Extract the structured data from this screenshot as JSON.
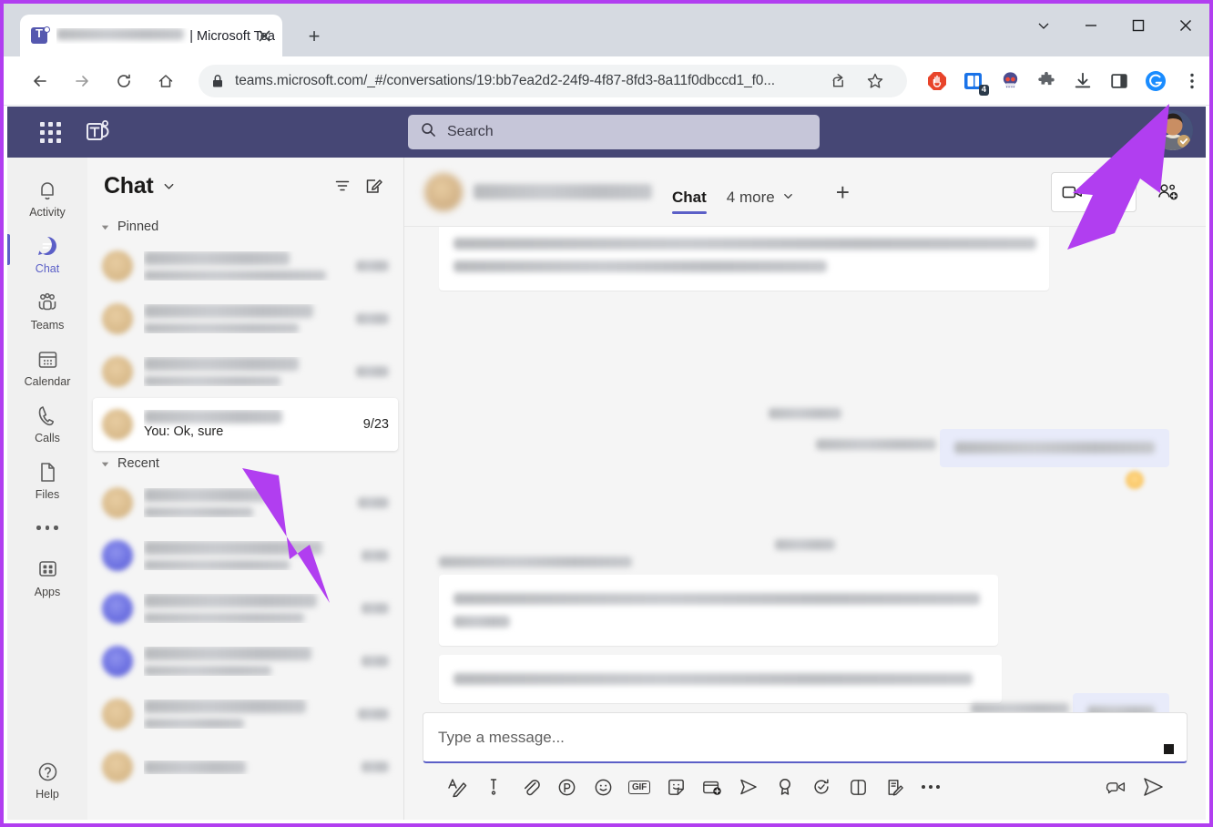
{
  "browser": {
    "tab": {
      "title_suffix": "| Microsoft Tea",
      "favicon": "teams-logo-icon",
      "close": "close-icon"
    },
    "new_tab_label": "+",
    "window_controls": {
      "tab_search": "chevron-down-icon",
      "minimize": "minimize-icon",
      "maximize": "maximize-icon",
      "close": "close-icon"
    },
    "nav": {
      "back": "back-arrow-icon",
      "forward": "forward-arrow-icon",
      "reload": "reload-icon",
      "home": "home-icon"
    },
    "omnibox": {
      "lock": "lock-icon",
      "url": "teams.microsoft.com/_#/conversations/19:bb7ea2d2-24f9-4f87-8fd3-8a11f0dbccd1_f0...",
      "share": "share-icon",
      "bookmark": "star-icon"
    },
    "extensions": [
      {
        "name": "adblock-icon",
        "color": "#e8442a"
      },
      {
        "name": "tab-manager-icon",
        "color": "#1a73e8",
        "badge": "4"
      },
      {
        "name": "skull-emoji-icon",
        "color": "#5b5fc7"
      },
      {
        "name": "puzzle-piece-icon",
        "color": "#5f6368"
      },
      {
        "name": "download-icon",
        "color": "#3c4043"
      },
      {
        "name": "side-panel-icon",
        "color": "#3c4043"
      },
      {
        "name": "grammarly-icon",
        "color": "#1a8cff"
      },
      {
        "name": "chrome-menu-icon",
        "color": "#3c4043"
      }
    ]
  },
  "teams": {
    "topbar": {
      "waffle": "app-grid-icon",
      "logo": "teams-logo-icon",
      "search_placeholder": "Search",
      "search_icon": "search-icon",
      "avatar": "user-avatar"
    },
    "rail": [
      {
        "label": "Activity",
        "icon": "bell-icon",
        "active": false
      },
      {
        "label": "Chat",
        "icon": "chat-bubble-icon",
        "active": true
      },
      {
        "label": "Teams",
        "icon": "people-icon",
        "active": false
      },
      {
        "label": "Calendar",
        "icon": "calendar-icon",
        "active": false
      },
      {
        "label": "Calls",
        "icon": "phone-icon",
        "active": false
      },
      {
        "label": "Files",
        "icon": "file-icon",
        "active": false
      }
    ],
    "rail_more": "more-icon",
    "rail_apps": {
      "label": "Apps",
      "icon": "apps-grid-icon"
    },
    "rail_help": {
      "label": "Help",
      "icon": "help-circle-icon"
    },
    "chatlist": {
      "title": "Chat",
      "title_chevron": "chevron-down-icon",
      "filter_icon": "filter-icon",
      "compose_icon": "new-chat-icon",
      "sections": [
        {
          "label": "Pinned",
          "rows": [
            {
              "avatar": "tan",
              "name_redacted": true,
              "sub_redacted": true,
              "time_redacted": true,
              "selected": false
            },
            {
              "avatar": "tan",
              "name_redacted": true,
              "sub_redacted": true,
              "time_redacted": true,
              "selected": false
            },
            {
              "avatar": "tan",
              "name_redacted": true,
              "sub_redacted": true,
              "time_redacted": true,
              "selected": false
            },
            {
              "avatar": "tan",
              "name_redacted": true,
              "sub_text": "You: Ok, sure",
              "time": "9/23",
              "selected": true
            }
          ]
        },
        {
          "label": "Recent",
          "rows": [
            {
              "avatar": "tan",
              "name_redacted": true,
              "sub_redacted": true,
              "time_redacted": true,
              "selected": false
            },
            {
              "avatar": "purple",
              "name_redacted": true,
              "sub_redacted": true,
              "time_redacted": true,
              "selected": false
            },
            {
              "avatar": "purple",
              "name_redacted": true,
              "sub_redacted": true,
              "time_redacted": true,
              "selected": false
            },
            {
              "avatar": "purple",
              "name_redacted": true,
              "sub_redacted": true,
              "time_redacted": true,
              "selected": false
            },
            {
              "avatar": "tan",
              "name_redacted": true,
              "sub_redacted": true,
              "time_redacted": true,
              "selected": false
            },
            {
              "avatar": "tan",
              "name_redacted": true,
              "sub_redacted": true,
              "time_redacted": true,
              "selected": false
            }
          ]
        }
      ]
    },
    "conversation": {
      "header": {
        "avatar": "contact-avatar",
        "name_redacted": true,
        "tabs": [
          {
            "label": "Chat",
            "active": true
          },
          {
            "label": "4 more",
            "active": false,
            "chevron": "chevron-down-icon"
          }
        ],
        "add_tab": "+",
        "video_call": "video-call-icon",
        "audio_call": "phone-call-icon",
        "add_people": "add-people-icon"
      },
      "messages": [
        {
          "side": "in",
          "redacted": true,
          "lines": 2
        },
        {
          "divider": true,
          "redacted": true
        },
        {
          "side": "out",
          "meta_redacted": true,
          "redacted": true,
          "lines": 1,
          "reaction": true
        },
        {
          "divider": true,
          "redacted": true
        },
        {
          "side": "in",
          "meta_redacted": true,
          "redacted": true,
          "lines": 2
        },
        {
          "side": "in",
          "redacted": true,
          "lines": 1
        },
        {
          "side": "out",
          "meta_redacted": true,
          "redacted": true,
          "lines": 1,
          "reaction": true
        }
      ]
    },
    "compose": {
      "placeholder": "Type a message...",
      "tools_left": [
        "format-text-icon",
        "importance-icon",
        "attach-file-icon",
        "loop-component-icon",
        "emoji-icon",
        "gif-icon",
        "sticker-icon",
        "schedule-meeting-icon",
        "send-later-icon",
        "praise-icon",
        "approvals-icon",
        "compare-icon",
        "forms-icon",
        "more-options-icon"
      ],
      "gif_label": "GIF",
      "tools_right": [
        "video-message-icon",
        "send-icon"
      ]
    }
  },
  "annotations": {
    "arrow_color": "#b13ef0",
    "arrows": [
      {
        "name": "arrow-to-profile-avatar"
      },
      {
        "name": "arrow-to-selected-chat"
      }
    ],
    "border_color": "#b13ef0"
  }
}
